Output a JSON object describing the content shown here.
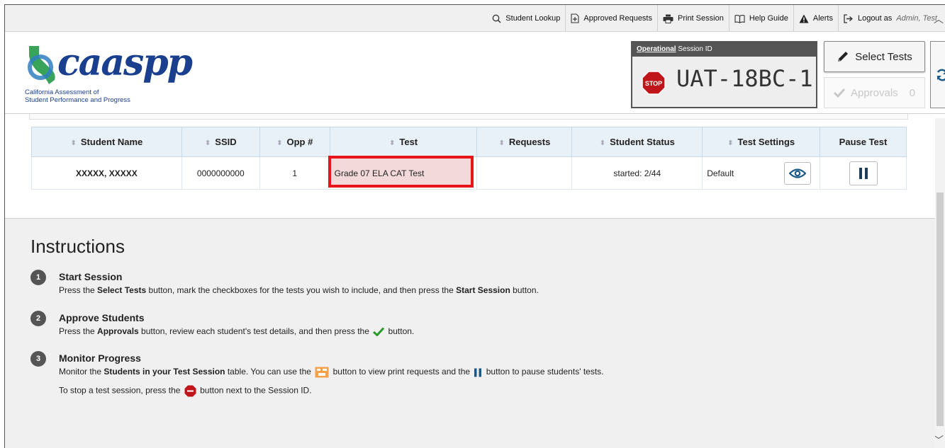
{
  "topbar": {
    "links": [
      {
        "label": "Student Lookup",
        "icon": "search-icon"
      },
      {
        "label": "Approved Requests",
        "icon": "plus-document-icon"
      },
      {
        "label": "Print Session",
        "icon": "printer-icon"
      },
      {
        "label": "Help Guide",
        "icon": "book-icon"
      },
      {
        "label": "Alerts",
        "icon": "warning-icon"
      },
      {
        "label": "Logout as",
        "icon": "logout-icon"
      }
    ],
    "user": "Admin, Test"
  },
  "logo": {
    "word": "caaspp",
    "sub1": "California Assessment of",
    "sub2": "Student Performance and Progress"
  },
  "session": {
    "label_op": "Operational",
    "label_rest": " Session ID",
    "id": "UAT-18BC-1",
    "stop_text": "STOP"
  },
  "buttons": {
    "select_tests": "Select Tests",
    "approvals": "Approvals",
    "approvals_count": "0"
  },
  "table": {
    "headers": [
      "Student Name",
      "SSID",
      "Opp #",
      "Test",
      "Requests",
      "Student Status",
      "Test Settings",
      "Pause Test"
    ],
    "rows": [
      {
        "name": "XXXXX, XXXXX",
        "ssid": "0000000000",
        "opp": "1",
        "test": "Grade 07 ELA CAT Test",
        "requests": "",
        "status": "started: 2/44",
        "settings": "Default"
      }
    ]
  },
  "instructions": {
    "heading": "Instructions",
    "steps": [
      {
        "num": "1",
        "title": "Start Session",
        "desc_a": "Press the ",
        "desc_b": "Select Tests",
        "desc_c": " button, mark the checkboxes for the tests you wish to include, and then press the ",
        "desc_d": "Start Session",
        "desc_e": " button."
      },
      {
        "num": "2",
        "title": "Approve Students",
        "desc_a": "Press the ",
        "desc_b": "Approvals",
        "desc_c": " button, review each student's test details, and then press the ",
        "desc_e": " button."
      },
      {
        "num": "3",
        "title": "Monitor Progress",
        "desc_a": "Monitor the ",
        "desc_b": "Students in your Test Session",
        "desc_c": " table. You can use the ",
        "desc_d": " button to view print requests and the ",
        "desc_e": " button to pause students' tests.",
        "line2_a": "To stop a test session, press the ",
        "line2_b": " button next to the Session ID."
      }
    ]
  },
  "colors": {
    "highlight_border": "#e8141c",
    "stop_red": "#c0151b",
    "eye_blue": "#1b5a87",
    "check_green": "#2a9a2a"
  }
}
